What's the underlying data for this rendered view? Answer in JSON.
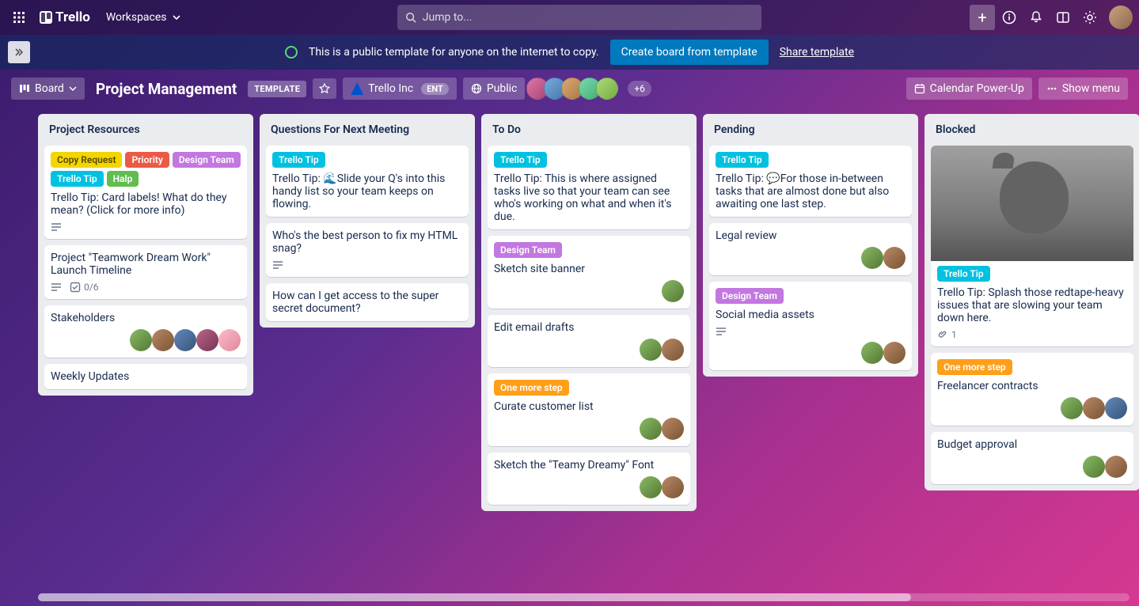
{
  "nav": {
    "brand": "Trello",
    "workspaces": "Workspaces",
    "search_placeholder": "Jump to..."
  },
  "banner": {
    "message": "This is a public template for anyone on the internet to copy.",
    "create": "Create board from template",
    "share": "Share template"
  },
  "board_header": {
    "view": "Board",
    "title": "Project Management",
    "template_badge": "TEMPLATE",
    "workspace_name": "Trello Inc",
    "workspace_tier": "ENT",
    "visibility": "Public",
    "members_more": "+6",
    "calendar": "Calendar Power-Up",
    "show_menu": "Show menu"
  },
  "labels": {
    "copy_request": "Copy Request",
    "priority": "Priority",
    "design_team": "Design Team",
    "trello_tip": "Trello Tip",
    "halp": "Halp",
    "one_more_step": "One more step"
  },
  "lists": [
    {
      "title": "Project Resources",
      "cards": [
        {
          "labels": [
            "copy_request",
            "priority",
            "design_team",
            "trello_tip",
            "halp"
          ],
          "text": "Trello Tip: Card labels! What do they mean? (Click for more info)",
          "desc": true
        },
        {
          "text": "Project \"Teamwork Dream Work\" Launch Timeline",
          "desc": true,
          "checklist": "0/6"
        },
        {
          "text": "Stakeholders",
          "members": 5
        },
        {
          "text": "Weekly Updates"
        }
      ]
    },
    {
      "title": "Questions For Next Meeting",
      "cards": [
        {
          "labels": [
            "trello_tip"
          ],
          "text": "Trello Tip: 🌊Slide your Q's into this handy list so your team keeps on flowing."
        },
        {
          "text": "Who's the best person to fix my HTML snag?",
          "desc": true
        },
        {
          "text": "How can I get access to the super secret document?"
        }
      ]
    },
    {
      "title": "To Do",
      "cards": [
        {
          "labels": [
            "trello_tip"
          ],
          "text": "Trello Tip: This is where assigned tasks live so that your team can see who's working on what and when it's due."
        },
        {
          "labels": [
            "design_team"
          ],
          "text": "Sketch site banner",
          "members": 1
        },
        {
          "text": "Edit email drafts",
          "members": 2
        },
        {
          "labels": [
            "one_more_step"
          ],
          "text": "Curate customer list",
          "members": 2
        },
        {
          "text": "Sketch the \"Teamy Dreamy\" Font",
          "members": 2
        }
      ]
    },
    {
      "title": "Pending",
      "cards": [
        {
          "labels": [
            "trello_tip"
          ],
          "text": "Trello Tip: 💬For those in-between tasks that are almost done but also awaiting one last step."
        },
        {
          "text": "Legal review",
          "members": 2
        },
        {
          "labels": [
            "design_team"
          ],
          "text": "Social media assets",
          "desc": true,
          "members": 2
        }
      ]
    },
    {
      "title": "Blocked",
      "cards": [
        {
          "cover": true,
          "labels": [
            "trello_tip"
          ],
          "text": "Trello Tip: Splash those redtape-heavy issues that are slowing your team down here.",
          "attach": "1"
        },
        {
          "labels": [
            "one_more_step"
          ],
          "text": "Freelancer contracts",
          "members": 3
        },
        {
          "text": "Budget approval",
          "members": 2
        }
      ]
    }
  ]
}
